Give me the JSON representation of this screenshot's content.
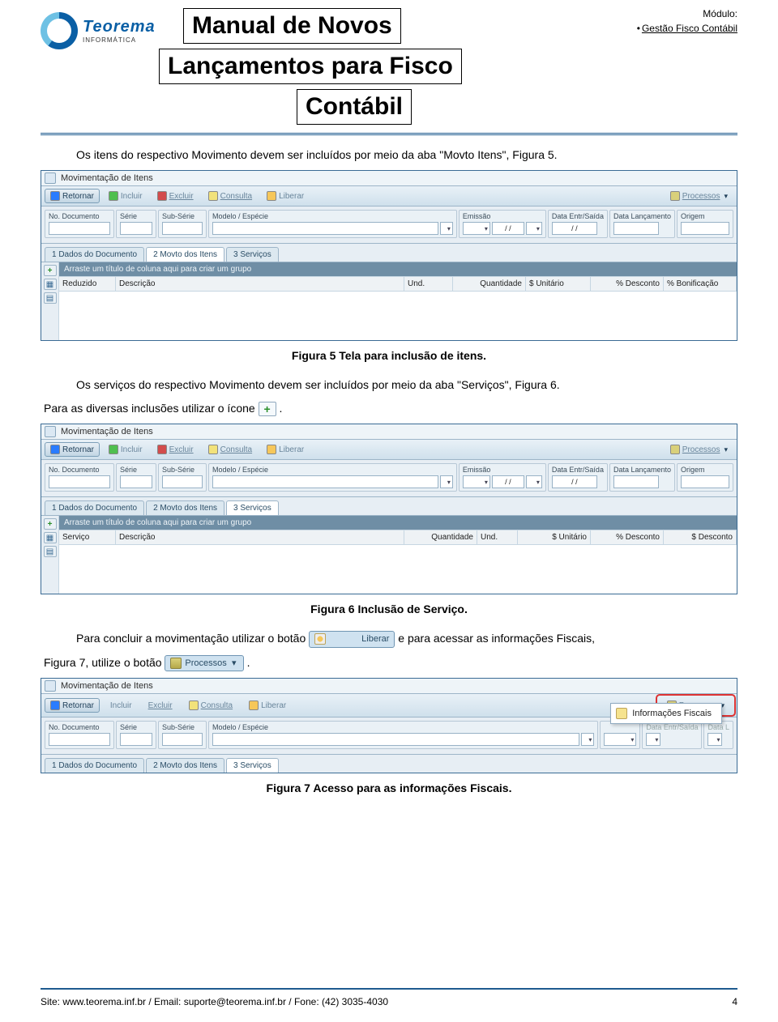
{
  "logo": {
    "brand": "Teorema",
    "sub": "INFORMÁTICA"
  },
  "header": {
    "title1": "Manual de Novos",
    "title2": "Lançamentos para Fisco",
    "title3": "Contábil",
    "module_label": "Módulo:",
    "module_item": "Gestão Fisco Contábil"
  },
  "para1": "Os itens do respectivo Movimento devem ser incluídos por meio da aba \"Movto Itens\", Figura 5.",
  "caption5": "Figura 5 Tela para inclusão de itens.",
  "para2": "Os serviços do respectivo Movimento devem ser incluídos por meio da aba \"Serviços\", Figura 6.",
  "para3_a": "Para as diversas inclusões utilizar o ícone ",
  "para3_b": ".",
  "caption6": "Figura 6 Inclusão de Serviço.",
  "para4_a": "Para concluir a movimentação utilizar o botão ",
  "btn_liberar": "Liberar",
  "para4_b": " e para acessar as informações Fiscais,",
  "para5_a": "Figura 7, utilize o botão ",
  "btn_processos": "Processos",
  "para5_b": ".",
  "caption7": "Figura 7 Acesso para as informações Fiscais.",
  "footer_left": "Site: www.teorema.inf.br / Email: suporte@teorema.inf.br / Fone: (42) 3035-4030",
  "footer_right": "4",
  "shot_common": {
    "window_title": "Movimentação de Itens",
    "tb_retornar": "Retornar",
    "tb_incluir": "Incluir",
    "tb_excluir": "Excluir",
    "tb_consulta": "Consulta",
    "tb_liberar": "Liberar",
    "tb_processos": "Processos",
    "f_doc": "No. Documento",
    "f_serie": "Série",
    "f_sub": "Sub-Série",
    "f_modelo": "Modelo / Espécie",
    "f_emissao": "Emissão",
    "f_entrsaida": "Data Entr/Saída",
    "f_lanc": "Data Lançamento",
    "f_origem": "Origem",
    "date_ph": "/ /",
    "group_hint": "Arraste um título de coluna aqui para criar um grupo",
    "tab1": "1 Dados do Documento",
    "tab2": "2 Movto dos Itens",
    "tab3": "3 Serviços"
  },
  "shot5": {
    "cols": [
      "Reduzido",
      "Descrição",
      "Und.",
      "Quantidade",
      "$ Unitário",
      "% Desconto",
      "% Bonificação"
    ]
  },
  "shot6": {
    "cols": [
      "Serviço",
      "Descrição",
      "Quantidade",
      "Und.",
      "$ Unitário",
      "% Desconto",
      "$ Desconto"
    ]
  },
  "shot7": {
    "menu_item": "Informações Fiscais",
    "f_lanc_short": "Data L"
  }
}
